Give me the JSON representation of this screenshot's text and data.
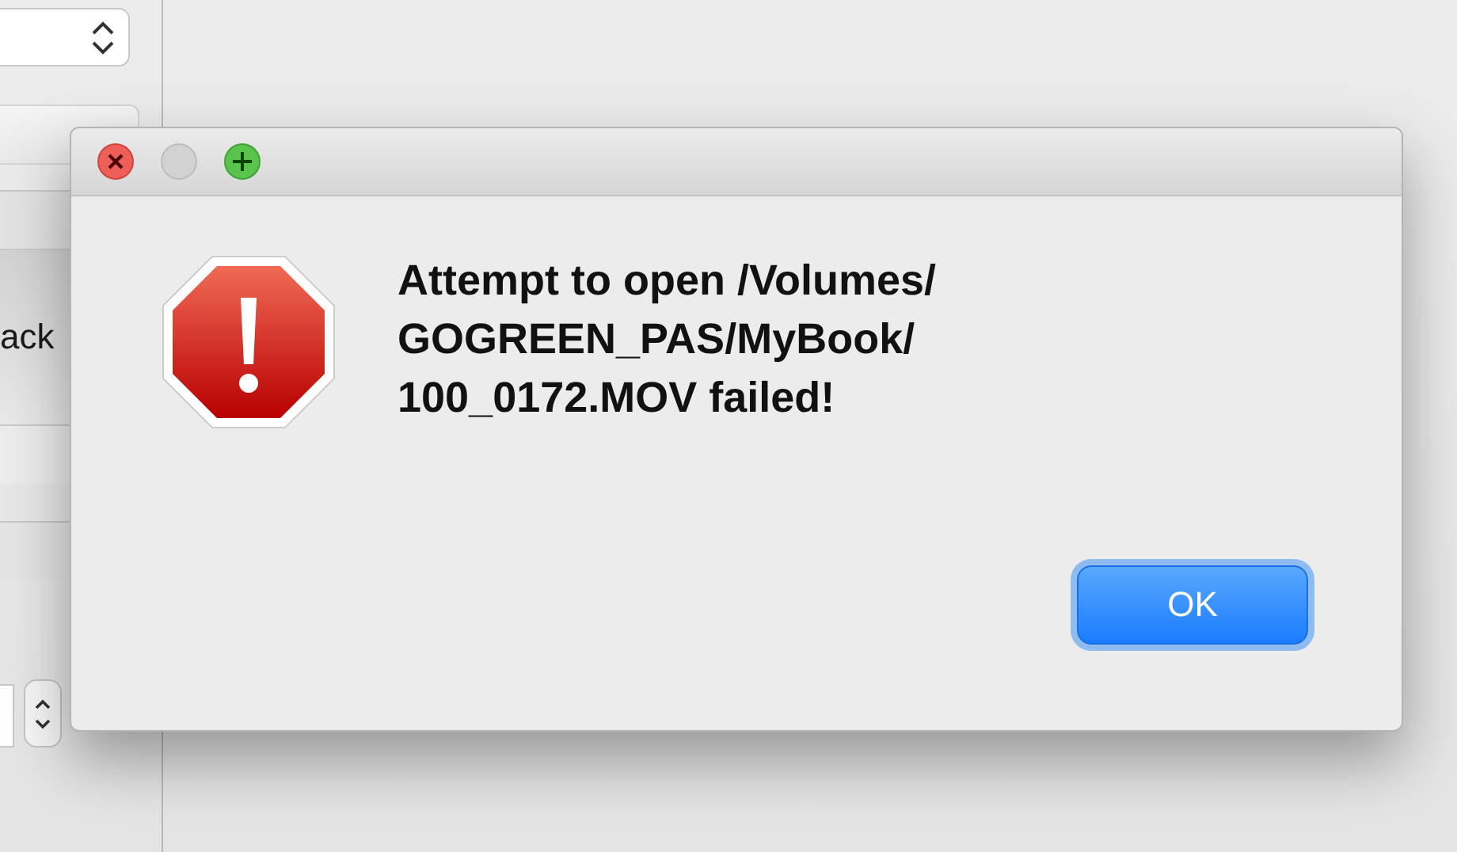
{
  "background": {
    "side_label": "ack"
  },
  "dialog": {
    "window_controls": [
      {
        "kind": "close"
      },
      {
        "kind": "minimize"
      },
      {
        "kind": "zoom"
      }
    ],
    "message": "Attempt to open /Volumes/GOGREEN_PAS/MyBook/100_0172.MOV failed!",
    "button": {
      "label": "OK",
      "focused": true
    }
  }
}
